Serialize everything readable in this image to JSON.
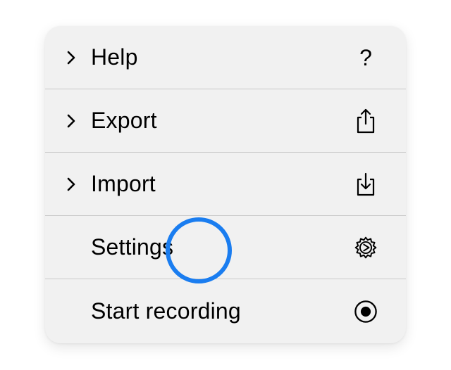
{
  "menu": {
    "items": [
      {
        "label": "Help",
        "has_submenu": true,
        "icon": "question-mark-icon",
        "icon_text": "?"
      },
      {
        "label": "Export",
        "has_submenu": true,
        "icon": "share-upload-icon"
      },
      {
        "label": "Import",
        "has_submenu": true,
        "icon": "download-tray-icon"
      },
      {
        "label": "Settings",
        "has_submenu": false,
        "icon": "gear-icon"
      },
      {
        "label": "Start recording",
        "has_submenu": false,
        "icon": "record-icon"
      }
    ]
  },
  "colors": {
    "menu_bg": "#f1f1f1",
    "divider": "#c9c9c9",
    "cursor_ring": "#1a7df0"
  }
}
